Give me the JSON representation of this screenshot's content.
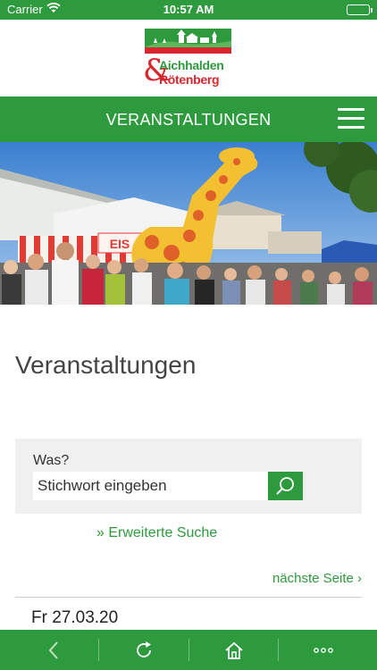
{
  "status_bar": {
    "carrier": "Carrier",
    "time": "10:57 AM"
  },
  "logo": {
    "line1": "Aichhalden",
    "line2": "Rötenberg",
    "ampersand": "&"
  },
  "nav": {
    "title": "VERANSTALTUNGEN"
  },
  "hero": {
    "stand_sign": "EIS"
  },
  "page": {
    "title": "Veranstaltungen"
  },
  "search": {
    "label": "Was?",
    "placeholder": "Stichwort eingeben"
  },
  "links": {
    "advanced_search": "» Erweiterte Suche",
    "next_page": "nächste Seite ›"
  },
  "events": [
    {
      "date": "Fr 27.03.20"
    }
  ],
  "icons": {
    "menu": "hamburger-icon",
    "search": "search-icon",
    "back": "chevron-left-icon",
    "reload": "reload-icon",
    "home": "home-icon",
    "more": "more-icon"
  },
  "colors": {
    "brand_green": "#2e9a3e",
    "brand_red": "#d8262e"
  }
}
